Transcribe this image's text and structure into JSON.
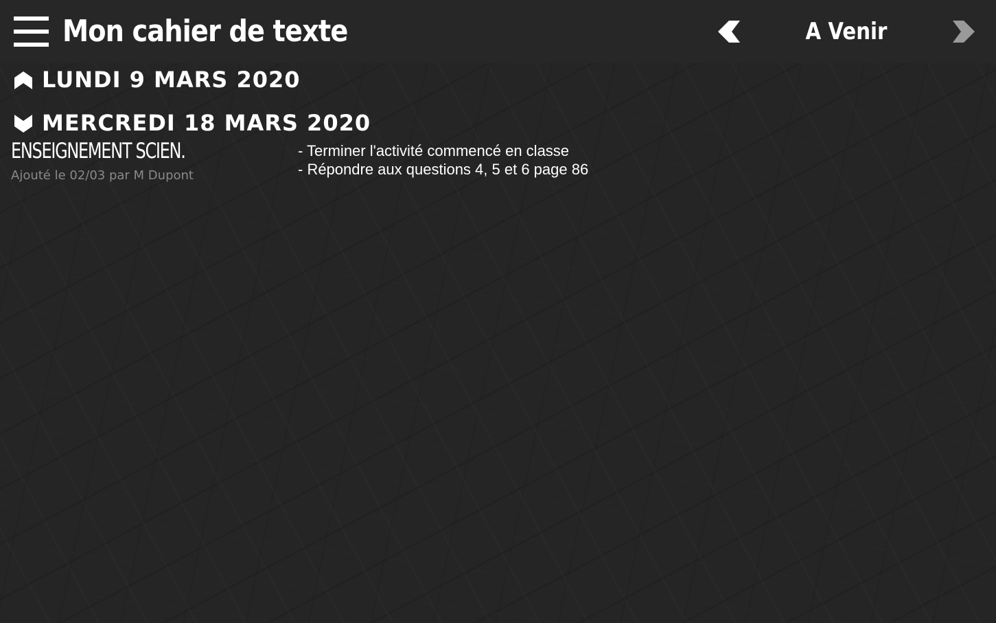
{
  "header": {
    "title": "Mon cahier de texte",
    "menu_icon": "hamburger-menu-icon",
    "prev_icon": "chevron-left-icon",
    "next_icon": "chevron-right-icon",
    "period_label": "A Venir"
  },
  "days": [
    {
      "label": "LUNDI 9 MARS 2020",
      "state": "collapsed",
      "icon": "chevron-up-icon"
    },
    {
      "label": "MERCREDI 18 MARS 2020",
      "state": "expanded",
      "icon": "chevron-down-icon",
      "entries": [
        {
          "subject": "ENSEIGNEMENT SCIEN.",
          "added_by": "Ajouté le 02/03 par M Dupont",
          "tasks": [
            "- Terminer l'activité commencé en classe",
            "- Répondre aux questions 4, 5 et 6 page 86"
          ]
        }
      ]
    }
  ],
  "colors": {
    "background": "#252525",
    "header_background": "#272727",
    "text": "#ffffff",
    "muted_text": "#8a8a8a",
    "disabled_icon": "#9a9a9a"
  }
}
